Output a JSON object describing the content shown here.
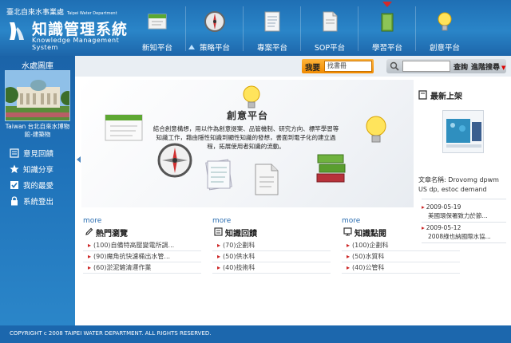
{
  "header": {
    "dept_name": "臺北自來水事業處",
    "dept_name_en": "Taipei Water Department",
    "system_title": "知識管理系統",
    "system_subtitle": "Knowledge Management System",
    "nav": [
      {
        "label": "新知平台",
        "icon": "book-icon"
      },
      {
        "label": "策略平台",
        "icon": "compass-icon"
      },
      {
        "label": "專案平台",
        "icon": "document-icon"
      },
      {
        "label": "SOP平台",
        "icon": "file-icon"
      },
      {
        "label": "學習平台",
        "icon": "book-stack-icon",
        "active": true
      },
      {
        "label": "創意平台",
        "icon": "lightbulb-icon"
      }
    ]
  },
  "sidebar": {
    "library_title": "水處圖庫",
    "photo_caption": "Taiwan 台北自來水博物館-建築物",
    "links": [
      {
        "label": "意見回饋",
        "icon": "feedback-icon"
      },
      {
        "label": "知識分享",
        "icon": "star-icon"
      },
      {
        "label": "我的最愛",
        "icon": "checklist-icon"
      },
      {
        "label": "系統登出",
        "icon": "lock-icon"
      }
    ]
  },
  "search": {
    "keyword_label": "我要",
    "keyword_select": "找書冊",
    "search_button": "查詢",
    "advanced_button": "進階搜尋"
  },
  "banner": {
    "title": "創意平台",
    "text": "結合創意構想，用以作為創意提案、品管機制、研究方向、標竿學習等知識工作，藉由隱性知識到顯性知識的發想，書面到電子化的建立過程，拓展使用者知識的流動。"
  },
  "latest": {
    "title": "最新上架",
    "book_name": "文章名稱: Drovomg dpwm US dp, estoc demand",
    "items": [
      {
        "date": "2009-05-19",
        "text": "美國環保署致力於節..."
      },
      {
        "date": "2009-05-12",
        "text": "2008綠也納國際水協..."
      }
    ]
  },
  "columns": [
    {
      "more": "more",
      "title": "熱門瀏覽",
      "icon": "pencil-icon",
      "items": [
        "(100)自備特高壓變電所調...",
        "(90)魔角抗快濾桶出水管...",
        "(60)淤泥鏟清運作業"
      ]
    },
    {
      "more": "more",
      "title": "知識回饋",
      "icon": "feedback-icon",
      "items": [
        "(70)企劃科",
        "(50)供水科",
        "(40)技術科"
      ]
    },
    {
      "more": "more",
      "title": "知識點閱",
      "icon": "monitor-icon",
      "items": [
        "(100)企劃科",
        "(50)水質科",
        "(40)公管科"
      ]
    }
  ],
  "footer": {
    "copyright": "COPYRIGHT c 2008 TAIPEI WATER DEPARTMENT. ALL RIGHTS RESERVED."
  }
}
